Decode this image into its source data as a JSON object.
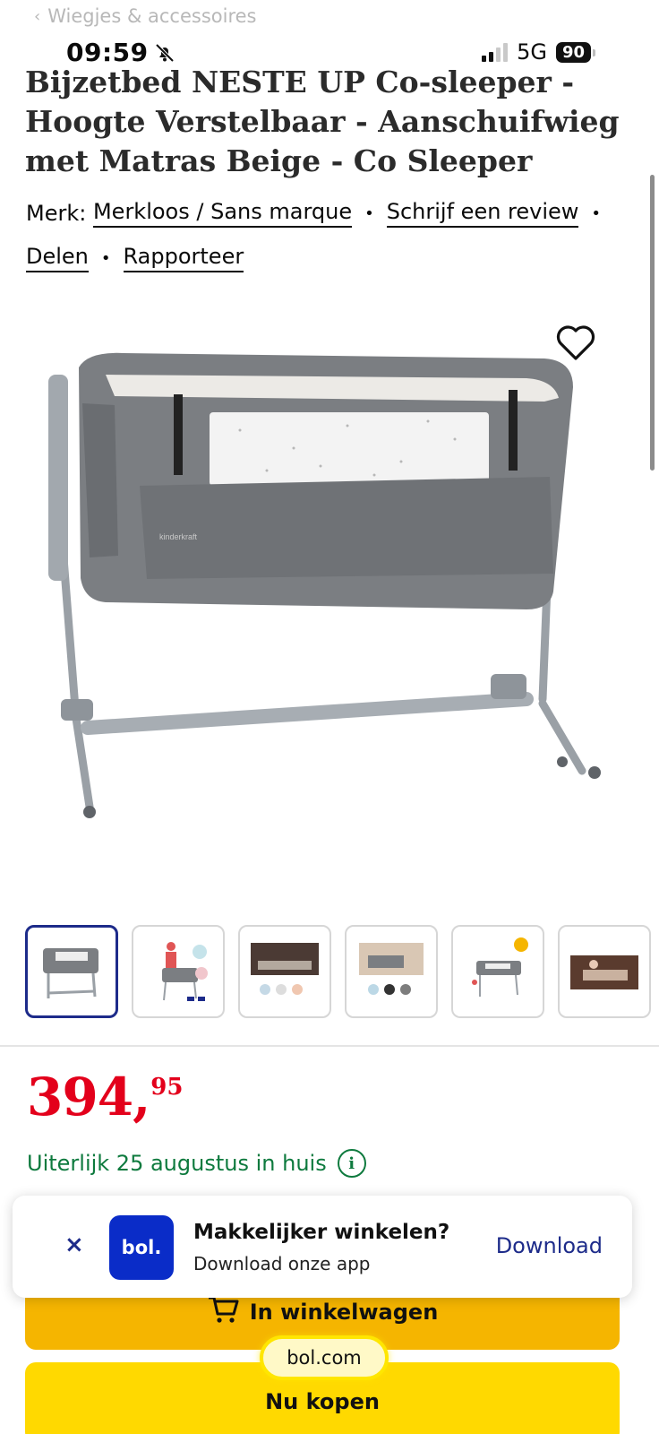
{
  "status_bar": {
    "time": "09:59",
    "network": "5G",
    "battery": "90"
  },
  "breadcrumb": "Wiegjes & accessoires",
  "product": {
    "title": "Bijzetbed NESTE UP Co-sleeper - Hoogte Verstelbaar - Aanschuifwieg met Matras Beige - Co Sleeper",
    "brand_label": "Merk:",
    "brand": "Merkloos / Sans marque",
    "review_link": "Schrijf een review",
    "share_link": "Delen",
    "report_link": "Rapporteer",
    "image_brand_print": "kinderkraft",
    "price_int": "394",
    "price_comma": ",",
    "price_cents": "95",
    "delivery": "Uiterlijk 25 augustus in huis"
  },
  "thumbnails": [
    "thumb-1",
    "thumb-2",
    "thumb-3",
    "thumb-4",
    "thumb-5",
    "thumb-6"
  ],
  "buttons": {
    "cart": "In winkelwagen",
    "buy": "Nu kopen"
  },
  "app_banner": {
    "close": "×",
    "logo": "bol.",
    "title": "Makkelijker winkelen?",
    "subtitle": "Download onze app",
    "cta": "Download"
  },
  "url_bar": "bol.com",
  "colors": {
    "price": "#e3001b",
    "delivery": "#0e7a3e",
    "brand_blue": "#0a2cc8",
    "cart_button": "#f5b500",
    "buy_button": "#ffd900"
  }
}
